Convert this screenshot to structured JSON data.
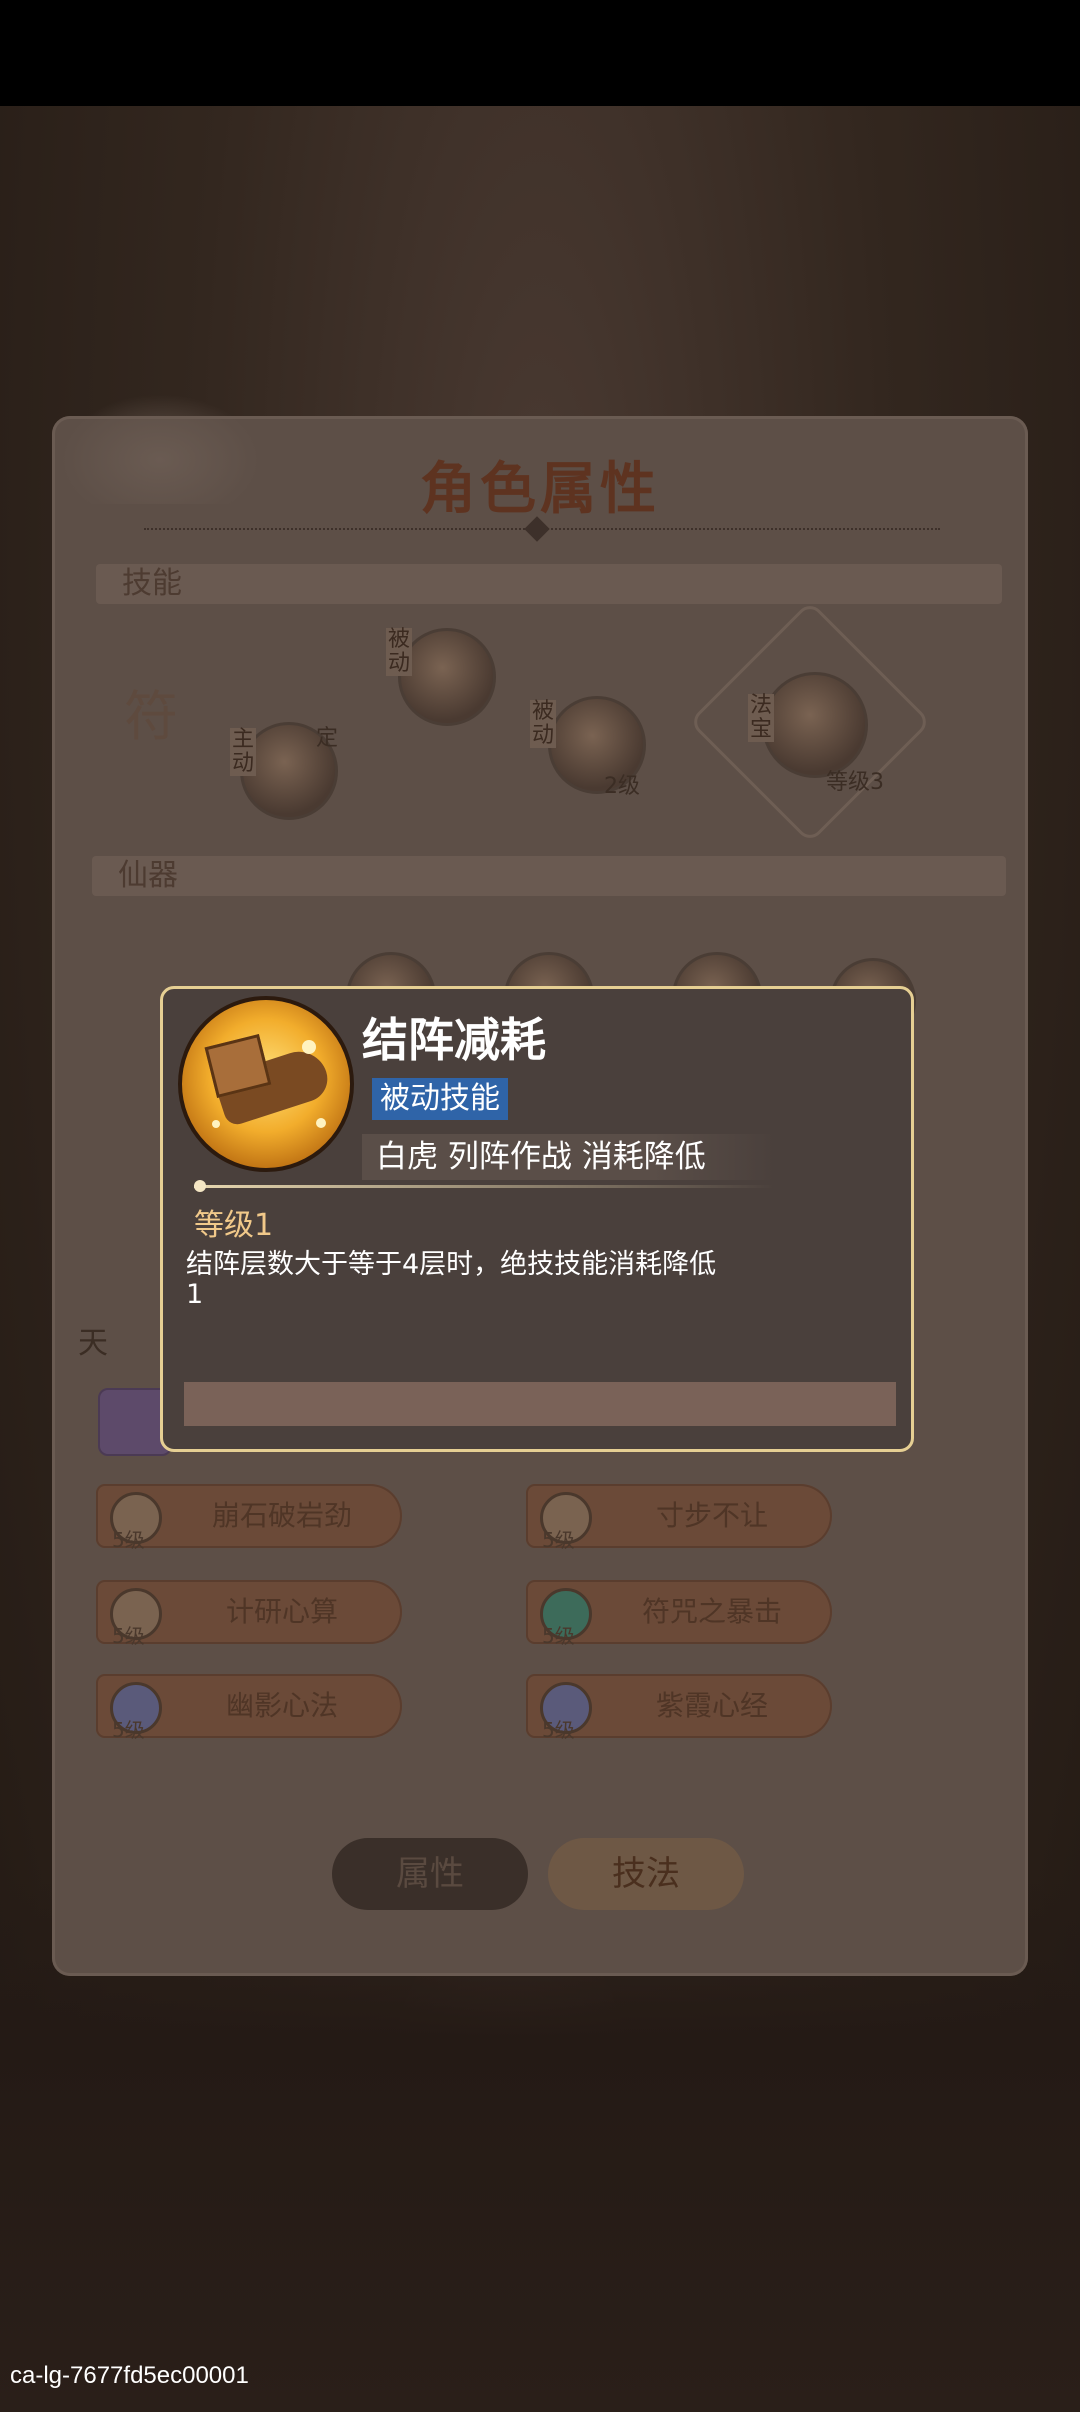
{
  "panel": {
    "title": "角色属性",
    "section_skills": "技能",
    "section_artifacts": "仙器",
    "section_talent": "天",
    "skill_tags": {
      "active": "主动",
      "passive": "被动",
      "passive2": "被动",
      "fabao": "法宝"
    },
    "skill_texts": {
      "fu": "符",
      "ding": "定",
      "level_2": "2级",
      "level_3": "等级3"
    },
    "talents": [
      {
        "name": "崩石破岩劲",
        "level": "5级"
      },
      {
        "name": "寸步不让",
        "level": "5级"
      },
      {
        "name": "计研心算",
        "level": "5级"
      },
      {
        "name": "符咒之暴击",
        "level": "5级"
      },
      {
        "name": "幽影心法",
        "level": "5级"
      },
      {
        "name": "紫霞心经",
        "level": "5级"
      }
    ],
    "tabs": {
      "attributes": "属性",
      "skills": "技法"
    }
  },
  "tooltip": {
    "title": "结阵减耗",
    "tag": "被动技能",
    "description": "白虎 列阵作战 消耗降低",
    "level": "等级1",
    "effect": "结阵层数大于等于4层时，绝技技能消耗降低1"
  },
  "footer": {
    "id": "ca-lg-7677fd5ec00001"
  }
}
